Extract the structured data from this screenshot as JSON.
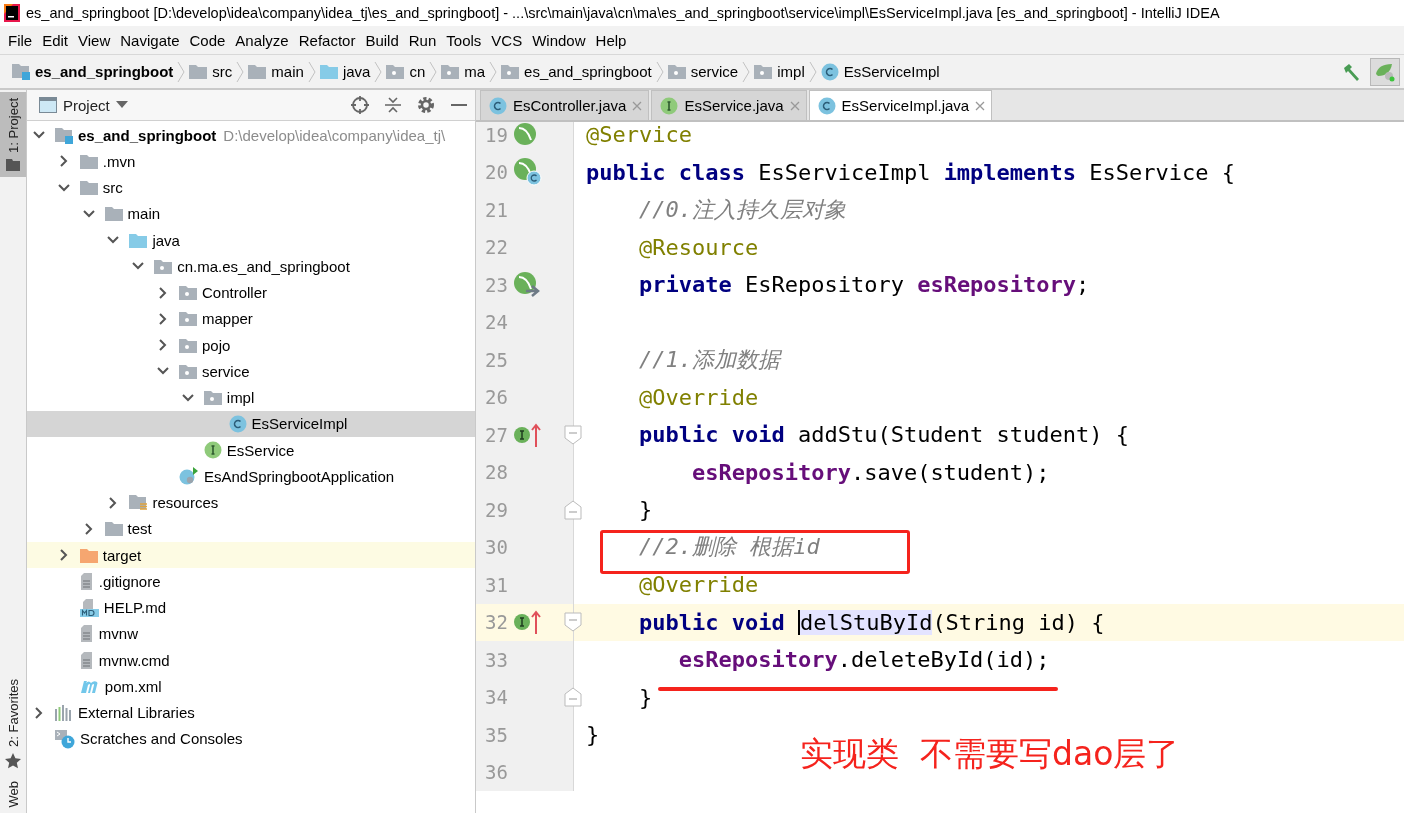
{
  "window": {
    "title": "es_and_springboot [D:\\develop\\idea\\company\\idea_tj\\es_and_springboot] - ...\\src\\main\\java\\cn\\ma\\es_and_springboot\\service\\impl\\EsServiceImpl.java [es_and_springboot] - IntelliJ IDEA"
  },
  "menu": [
    "File",
    "Edit",
    "View",
    "Navigate",
    "Code",
    "Analyze",
    "Refactor",
    "Build",
    "Run",
    "Tools",
    "VCS",
    "Window",
    "Help"
  ],
  "breadcrumbs": [
    {
      "label": "es_and_springboot",
      "kind": "module"
    },
    {
      "label": "src",
      "kind": "folder"
    },
    {
      "label": "main",
      "kind": "folder"
    },
    {
      "label": "java",
      "kind": "source-folder"
    },
    {
      "label": "cn",
      "kind": "package"
    },
    {
      "label": "ma",
      "kind": "package"
    },
    {
      "label": "es_and_springboot",
      "kind": "package"
    },
    {
      "label": "service",
      "kind": "package"
    },
    {
      "label": "impl",
      "kind": "package"
    },
    {
      "label": "EsServiceImpl",
      "kind": "class"
    }
  ],
  "side_tabs_top": [
    {
      "label": "1: Project",
      "selected": true
    }
  ],
  "side_tabs_bottom": [
    {
      "label": "2: Favorites",
      "selected": false
    },
    {
      "label": "Web",
      "selected": false
    }
  ],
  "project_panel": {
    "title": "Project",
    "tree": [
      {
        "label": "es_and_springboot",
        "path": "D:\\develop\\idea\\company\\idea_tj\\",
        "kind": "module",
        "expanded": true,
        "selected": false,
        "children": [
          {
            "label": ".mvn",
            "kind": "folder",
            "expanded": false,
            "selected": false
          },
          {
            "label": "src",
            "kind": "folder",
            "expanded": true,
            "selected": false,
            "children": [
              {
                "label": "main",
                "kind": "folder",
                "expanded": true,
                "selected": false,
                "children": [
                  {
                    "label": "java",
                    "kind": "source-folder",
                    "expanded": true,
                    "selected": false,
                    "children": [
                      {
                        "label": "cn.ma.es_and_springboot",
                        "kind": "package",
                        "expanded": true,
                        "selected": false,
                        "children": [
                          {
                            "label": "Controller",
                            "kind": "package",
                            "expanded": false,
                            "selected": false
                          },
                          {
                            "label": "mapper",
                            "kind": "package",
                            "expanded": false,
                            "selected": false
                          },
                          {
                            "label": "pojo",
                            "kind": "package",
                            "expanded": false,
                            "selected": false
                          },
                          {
                            "label": "service",
                            "kind": "package",
                            "expanded": true,
                            "selected": false,
                            "children": [
                              {
                                "label": "impl",
                                "kind": "package",
                                "expanded": true,
                                "selected": false,
                                "children": [
                                  {
                                    "label": "EsServiceImpl",
                                    "kind": "class",
                                    "selected": true
                                  }
                                ]
                              },
                              {
                                "label": "EsService",
                                "kind": "interface",
                                "selected": false
                              }
                            ]
                          },
                          {
                            "label": "EsAndSpringbootApplication",
                            "kind": "app-class",
                            "selected": false
                          }
                        ]
                      }
                    ]
                  },
                  {
                    "label": "resources",
                    "kind": "resources-folder",
                    "expanded": false,
                    "selected": false
                  }
                ]
              },
              {
                "label": "test",
                "kind": "folder",
                "expanded": false,
                "selected": false
              }
            ]
          },
          {
            "label": "target",
            "kind": "excluded-folder",
            "expanded": false,
            "selected": false,
            "highlighted": true
          },
          {
            "label": ".gitignore",
            "kind": "text-file",
            "selected": false
          },
          {
            "label": "HELP.md",
            "kind": "md-file",
            "selected": false
          },
          {
            "label": "mvnw",
            "kind": "text-file",
            "selected": false
          },
          {
            "label": "mvnw.cmd",
            "kind": "text-file",
            "selected": false
          },
          {
            "label": "pom.xml",
            "kind": "maven-file",
            "selected": false
          }
        ]
      },
      {
        "label": "External Libraries",
        "kind": "libraries",
        "expanded": false,
        "selected": false
      },
      {
        "label": "Scratches and Consoles",
        "kind": "scratches",
        "selected": false
      }
    ]
  },
  "editor": {
    "tabs": [
      {
        "label": "EsController.java",
        "kind": "class",
        "selected": false
      },
      {
        "label": "EsService.java",
        "kind": "interface",
        "selected": false
      },
      {
        "label": "EsServiceImpl.java",
        "kind": "class",
        "selected": true
      }
    ],
    "lines": [
      {
        "number": "19",
        "gutter": {
          "kind": "bean"
        },
        "tokens": [
          {
            "kind": "annotation",
            "text": "@Service"
          }
        ]
      },
      {
        "number": "20",
        "gutter": {
          "kind": "bean-class"
        },
        "tokens": [
          {
            "kind": "keyword",
            "text": "public class "
          },
          {
            "kind": "plain",
            "text": "EsServiceImpl "
          },
          {
            "kind": "keyword",
            "text": "implements "
          },
          {
            "kind": "plain",
            "text": "EsService {"
          }
        ]
      },
      {
        "number": "21",
        "tokens": [
          {
            "kind": "comment",
            "text": "    //0.注入持久层对象"
          }
        ]
      },
      {
        "number": "22",
        "tokens": [
          {
            "kind": "annotation",
            "text": "    @Resource"
          }
        ]
      },
      {
        "number": "23",
        "gutter": {
          "kind": "bean-inject"
        },
        "tokens": [
          {
            "kind": "keyword",
            "text": "    private "
          },
          {
            "kind": "plain",
            "text": "EsRepository "
          },
          {
            "kind": "field",
            "text": "esRepository"
          },
          {
            "kind": "plain",
            "text": ";"
          }
        ]
      },
      {
        "number": "24"
      },
      {
        "number": "25",
        "tokens": [
          {
            "kind": "comment",
            "text": "    //1.添加数据"
          }
        ]
      },
      {
        "number": "26",
        "tokens": [
          {
            "kind": "annotation",
            "text": "    @Override"
          }
        ]
      },
      {
        "number": "27",
        "gutter": {
          "kind": "implements"
        },
        "fold": {
          "kind": "start"
        },
        "tokens": [
          {
            "kind": "keyword",
            "text": "    public void "
          },
          {
            "kind": "plain",
            "text": "addStu(Student student) {"
          }
        ]
      },
      {
        "number": "28",
        "tokens": [
          {
            "kind": "field",
            "text": "        esRepository"
          },
          {
            "kind": "plain",
            "text": ".save(student);"
          }
        ]
      },
      {
        "number": "29",
        "fold": {
          "kind": "end"
        },
        "tokens": [
          {
            "kind": "plain",
            "text": "    }"
          }
        ]
      },
      {
        "number": "30",
        "mark": {
          "kind": "box"
        },
        "tokens": [
          {
            "kind": "comment",
            "text": "    //2.删除 根据id"
          }
        ]
      },
      {
        "number": "31",
        "tokens": [
          {
            "kind": "annotation",
            "text": "    @Override"
          }
        ]
      },
      {
        "number": "32",
        "gutter": {
          "kind": "implements"
        },
        "fold": {
          "kind": "start"
        },
        "current": true,
        "tokens": [
          {
            "kind": "keyword",
            "text": "    public void "
          },
          {
            "kind": "highlight",
            "text": "delStuById"
          },
          {
            "kind": "plain",
            "text": "(String id) {"
          }
        ]
      },
      {
        "number": "33",
        "mark": {
          "kind": "underline"
        },
        "tokens": [
          {
            "kind": "field",
            "text": "       esRepository"
          },
          {
            "kind": "plain",
            "text": ".deleteById(id);"
          }
        ]
      },
      {
        "number": "34",
        "fold": {
          "kind": "end"
        },
        "tokens": [
          {
            "kind": "plain",
            "text": "    }"
          }
        ]
      },
      {
        "number": "35",
        "tokens": [
          {
            "kind": "plain",
            "text": "}"
          }
        ]
      },
      {
        "number": "36"
      }
    ],
    "note": "实现类  不需要写dao层了"
  }
}
